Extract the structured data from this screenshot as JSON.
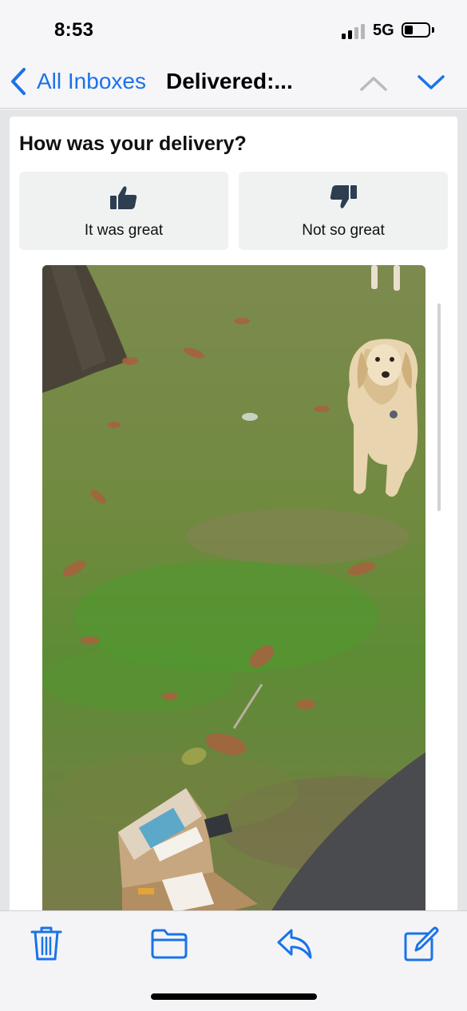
{
  "status_bar": {
    "time": "8:53",
    "network": "5G",
    "signal_bars_active": 2,
    "signal_bars_total": 4
  },
  "nav": {
    "back_label": "All Inboxes",
    "title": "Delivered:...",
    "back_icon": "chevron-left-icon",
    "prev_icon": "chevron-up-icon",
    "next_icon": "chevron-down-icon"
  },
  "email": {
    "survey_title": "How was your delivery?",
    "positive_label": "It was great",
    "negative_label": "Not so great",
    "photo_description_icon": "delivery-photo"
  },
  "toolbar": {
    "items": [
      "trash-icon",
      "folder-icon",
      "reply-icon",
      "compose-icon"
    ]
  },
  "colors": {
    "accent": "#1a73e8",
    "button_bg": "#f0f2f2",
    "thumb_icon": "#2c3e50"
  }
}
